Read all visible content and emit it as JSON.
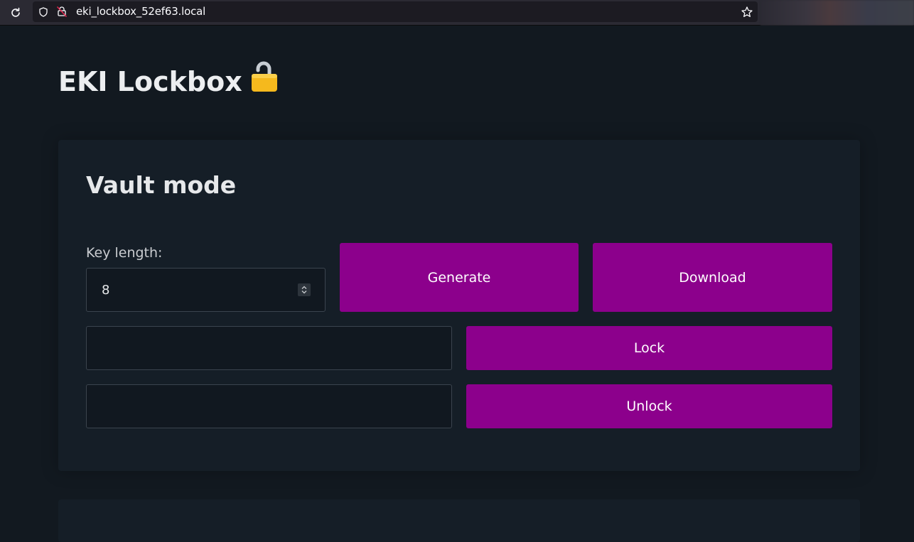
{
  "browser": {
    "url": "eki_lockbox_52ef63.local",
    "icons": {
      "reload": "reload-icon",
      "shield": "shield-icon",
      "insecure_lock": "insecure-lock-icon",
      "bookmark": "star-icon"
    }
  },
  "page": {
    "title": "EKI Lockbox",
    "title_icon": "🔓"
  },
  "vault": {
    "title": "Vault mode",
    "key_length_label": "Key length:",
    "key_length_value": "8",
    "generate_label": "Generate",
    "download_label": "Download",
    "lock_input_value": "",
    "lock_label": "Lock",
    "unlock_input_value": "",
    "unlock_label": "Unlock"
  },
  "colors": {
    "background": "#121920",
    "card": "#151e27",
    "button": "#8c008c",
    "input_border": "#3b444e"
  }
}
